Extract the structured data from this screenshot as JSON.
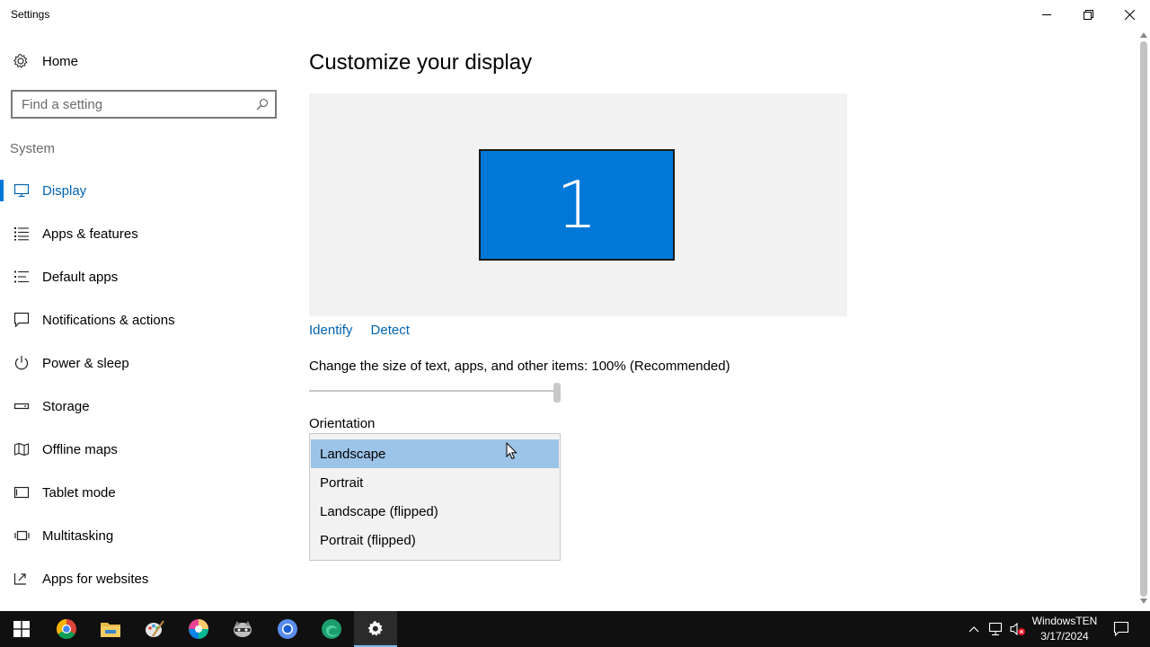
{
  "window": {
    "title": "Settings",
    "controls": [
      "minimize-icon",
      "restore-icon",
      "close-icon"
    ]
  },
  "sidebar": {
    "home_label": "Home",
    "search_placeholder": "Find a setting",
    "section_label": "System",
    "items": [
      {
        "label": "Display",
        "icon": "monitor-icon",
        "active": true
      },
      {
        "label": "Apps & features",
        "icon": "list-icon"
      },
      {
        "label": "Default apps",
        "icon": "default-apps-icon"
      },
      {
        "label": "Notifications & actions",
        "icon": "notifications-icon"
      },
      {
        "label": "Power & sleep",
        "icon": "power-icon"
      },
      {
        "label": "Storage",
        "icon": "storage-icon"
      },
      {
        "label": "Offline maps",
        "icon": "map-icon"
      },
      {
        "label": "Tablet mode",
        "icon": "tablet-icon"
      },
      {
        "label": "Multitasking",
        "icon": "multitasking-icon"
      },
      {
        "label": "Apps for websites",
        "icon": "apps-websites-icon"
      }
    ]
  },
  "main": {
    "title": "Customize your display",
    "monitor_number": "1",
    "identify_label": "Identify",
    "detect_label": "Detect",
    "scale_label": "Change the size of text, apps, and other items: 100% (Recommended)",
    "scale_slider_level": 1.0,
    "orientation_label": "Orientation",
    "orientation_options": [
      "Landscape",
      "Portrait",
      "Landscape (flipped)",
      "Portrait (flipped)"
    ],
    "orientation_selected": "Landscape"
  },
  "taskbar": {
    "apps": [
      "start-icon",
      "chrome-icon",
      "file-explorer-icon",
      "paint-icon",
      "color-app-icon",
      "raccoon-app-icon",
      "chromium-icon",
      "edge-icon",
      "settings-icon"
    ],
    "active_app": "settings-icon",
    "tray_icons": [
      "chevron-up-icon",
      "network-icon",
      "volume-muted-icon",
      "action-center-icon"
    ],
    "clock_name": "WindowsTEN",
    "clock_date": "3/17/2024"
  },
  "colors": {
    "accent": "#0078d7",
    "link": "#0063b1",
    "selected_option": "#9cc3e8",
    "preview_bg": "#f2f2f2",
    "taskbar": "#101010"
  }
}
